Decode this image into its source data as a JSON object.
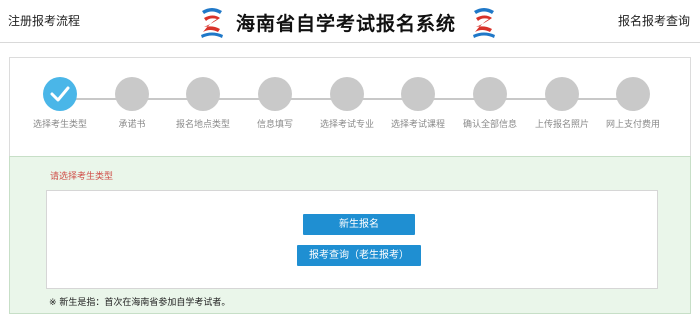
{
  "header": {
    "left_link": "注册报考流程",
    "title": "海南省自学考试报名系统",
    "right_link": "报名报考查询",
    "logo_icon": "province-exam-logo-icon"
  },
  "colors": {
    "active_step": "#4ab6e8",
    "inactive_step": "#c9c9c9",
    "button": "#1f8fd2",
    "panel_green": "#eaf6ea",
    "prompt_red": "#d0504a"
  },
  "steps": [
    {
      "label": "选择考生类型",
      "status": "completed",
      "icon": "check-icon"
    },
    {
      "label": "承诺书",
      "status": "pending"
    },
    {
      "label": "报名地点类型",
      "status": "pending"
    },
    {
      "label": "信息填写",
      "status": "pending"
    },
    {
      "label": "选择考试专业",
      "status": "pending"
    },
    {
      "label": "选择考试课程",
      "status": "pending"
    },
    {
      "label": "确认全部信息",
      "status": "pending"
    },
    {
      "label": "上传报名照片",
      "status": "pending"
    },
    {
      "label": "网上支付费用",
      "status": "pending"
    }
  ],
  "main": {
    "prompt": "请选择考生类型",
    "new_button": "新生报名",
    "query_button": "报考查询（老生报考）",
    "note": "※ 新生是指：首次在海南省参加自学考试者。"
  }
}
